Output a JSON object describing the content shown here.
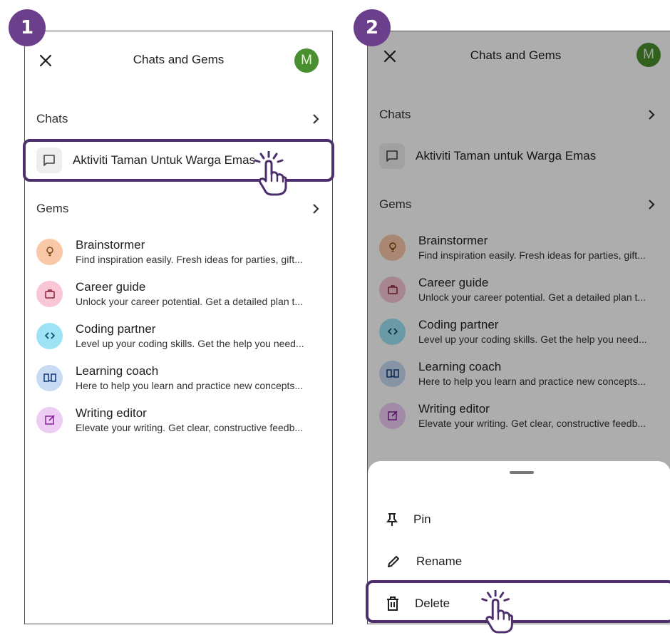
{
  "steps": [
    "1",
    "2"
  ],
  "screen": {
    "title": "Chats and Gems",
    "avatar_initial": "M",
    "chats_label": "Chats",
    "gems_label": "Gems"
  },
  "screen1": {
    "chat_title": "Aktiviti Taman Untuk Warga Emas"
  },
  "screen2": {
    "chat_title": "Aktiviti Taman untuk Warga Emas"
  },
  "gems": [
    {
      "name": "Brainstormer",
      "desc": "Find inspiration easily. Fresh ideas for parties, gift...",
      "icon": "lightbulb-icon",
      "color": "#f9c8a8"
    },
    {
      "name": "Career guide",
      "desc": "Unlock your career potential. Get a detailed plan t...",
      "icon": "briefcase-icon",
      "color": "#f8c6d4"
    },
    {
      "name": "Coding partner",
      "desc": "Level up your coding skills. Get the help you need...",
      "icon": "code-icon",
      "color": "#9de3f5"
    },
    {
      "name": "Learning coach",
      "desc": "Here to help you learn and practice new concepts...",
      "icon": "book-icon",
      "color": "#c8dbf5"
    },
    {
      "name": "Writing editor",
      "desc": "Elevate your writing. Get clear, constructive feedb...",
      "icon": "edit-icon",
      "color": "#eecdf5"
    }
  ],
  "sheet": {
    "pin_label": "Pin",
    "rename_label": "Rename",
    "delete_label": "Delete"
  },
  "colors": {
    "accent": "#4e2f6e",
    "badge": "#6b3f8c",
    "avatar": "#4a8f2f"
  }
}
